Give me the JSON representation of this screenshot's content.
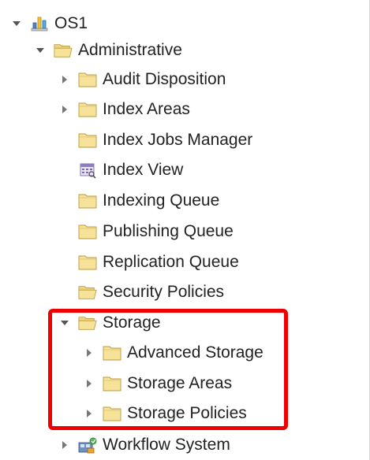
{
  "tree": {
    "root": {
      "label": "OS1",
      "icon": "object-store-icon",
      "expanded": true
    },
    "administrative": {
      "label": "Administrative",
      "icon": "folder-open-icon",
      "expanded": true
    },
    "items": [
      {
        "label": "Audit Disposition",
        "icon": "folder-icon",
        "has_children": true
      },
      {
        "label": "Index Areas",
        "icon": "folder-icon",
        "has_children": true
      },
      {
        "label": "Index Jobs Manager",
        "icon": "folder-icon",
        "has_children": false
      },
      {
        "label": "Index View",
        "icon": "index-view-icon",
        "has_children": false
      },
      {
        "label": "Indexing Queue",
        "icon": "folder-icon",
        "has_children": false
      },
      {
        "label": "Publishing Queue",
        "icon": "folder-icon",
        "has_children": false
      },
      {
        "label": "Replication Queue",
        "icon": "folder-icon",
        "has_children": false
      },
      {
        "label": "Security Policies",
        "icon": "folder-open-icon",
        "has_children": false
      }
    ],
    "storage": {
      "label": "Storage",
      "icon": "folder-open-icon",
      "expanded": true,
      "children": [
        {
          "label": "Advanced Storage",
          "icon": "folder-icon",
          "has_children": true
        },
        {
          "label": "Storage Areas",
          "icon": "folder-icon",
          "has_children": true
        },
        {
          "label": "Storage Policies",
          "icon": "folder-icon",
          "has_children": true
        }
      ]
    },
    "workflow": {
      "label": "Workflow System",
      "icon": "workflow-system-icon",
      "has_children": true
    }
  },
  "highlight_color": "#ee0000",
  "folder_color": "#f7e29a"
}
